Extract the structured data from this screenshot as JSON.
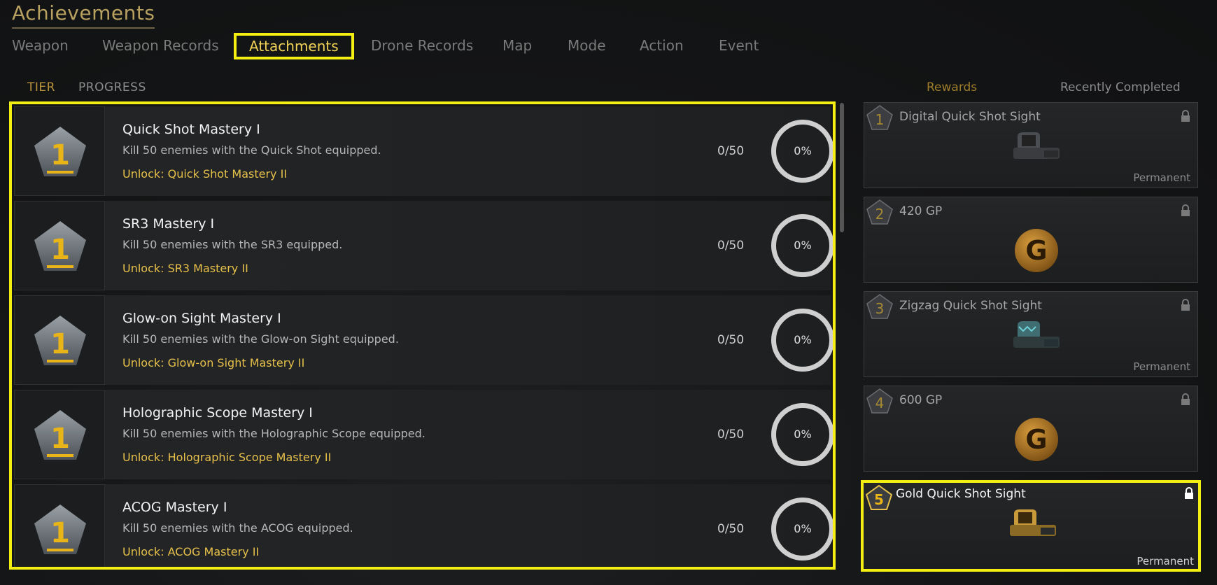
{
  "header": {
    "title": "Achievements"
  },
  "tabs": [
    {
      "label": "Weapon"
    },
    {
      "label": "Weapon Records"
    },
    {
      "label": "Attachments"
    },
    {
      "label": "Drone Records"
    },
    {
      "label": "Map"
    },
    {
      "label": "Mode"
    },
    {
      "label": "Action"
    },
    {
      "label": "Event"
    }
  ],
  "subtabs": [
    {
      "label": "TIER"
    },
    {
      "label": "PROGRESS"
    }
  ],
  "achievements": [
    {
      "tier": "1",
      "name": "Quick Shot Mastery I",
      "description": "Kill 50 enemies with the Quick Shot equipped.",
      "unlock": "Unlock: Quick Shot Mastery II",
      "count": "0/50",
      "percent": "0%"
    },
    {
      "tier": "1",
      "name": "SR3 Mastery I",
      "description": "Kill 50 enemies with the SR3 equipped.",
      "unlock": "Unlock: SR3 Mastery II",
      "count": "0/50",
      "percent": "0%"
    },
    {
      "tier": "1",
      "name": "Glow-on Sight Mastery I",
      "description": "Kill 50 enemies with the Glow-on Sight equipped.",
      "unlock": "Unlock: Glow-on Sight Mastery II",
      "count": "0/50",
      "percent": "0%"
    },
    {
      "tier": "1",
      "name": "Holographic Scope Mastery I",
      "description": "Kill 50 enemies with the Holographic Scope equipped.",
      "unlock": "Unlock: Holographic Scope Mastery II",
      "count": "0/50",
      "percent": "0%"
    },
    {
      "tier": "1",
      "name": "ACOG Mastery I",
      "description": "Kill 50 enemies with the ACOG equipped.",
      "unlock": "Unlock: ACOG Mastery II",
      "count": "0/50",
      "percent": "0%"
    }
  ],
  "rewards_panel": {
    "tabs": [
      {
        "label": "Rewards"
      },
      {
        "label": "Recently Completed"
      }
    ],
    "items": [
      {
        "tier": "1",
        "name": "Digital Quick Shot Sight",
        "duration": "Permanent",
        "icon": "sight-icon"
      },
      {
        "tier": "2",
        "name": "420 GP",
        "duration": "",
        "icon": "gp-coin-icon",
        "coin_letter": "G"
      },
      {
        "tier": "3",
        "name": "Zigzag Quick Shot Sight",
        "duration": "Permanent",
        "icon": "sight-icon"
      },
      {
        "tier": "4",
        "name": "600 GP",
        "duration": "",
        "icon": "gp-coin-icon",
        "coin_letter": "G"
      },
      {
        "tier": "5",
        "name": "Gold Quick Shot Sight",
        "duration": "Permanent",
        "icon": "sight-icon"
      }
    ]
  },
  "colors": {
    "highlight": "#f4ee12",
    "accent_gold": "#e6c04a",
    "title_gold": "#b8a060"
  }
}
